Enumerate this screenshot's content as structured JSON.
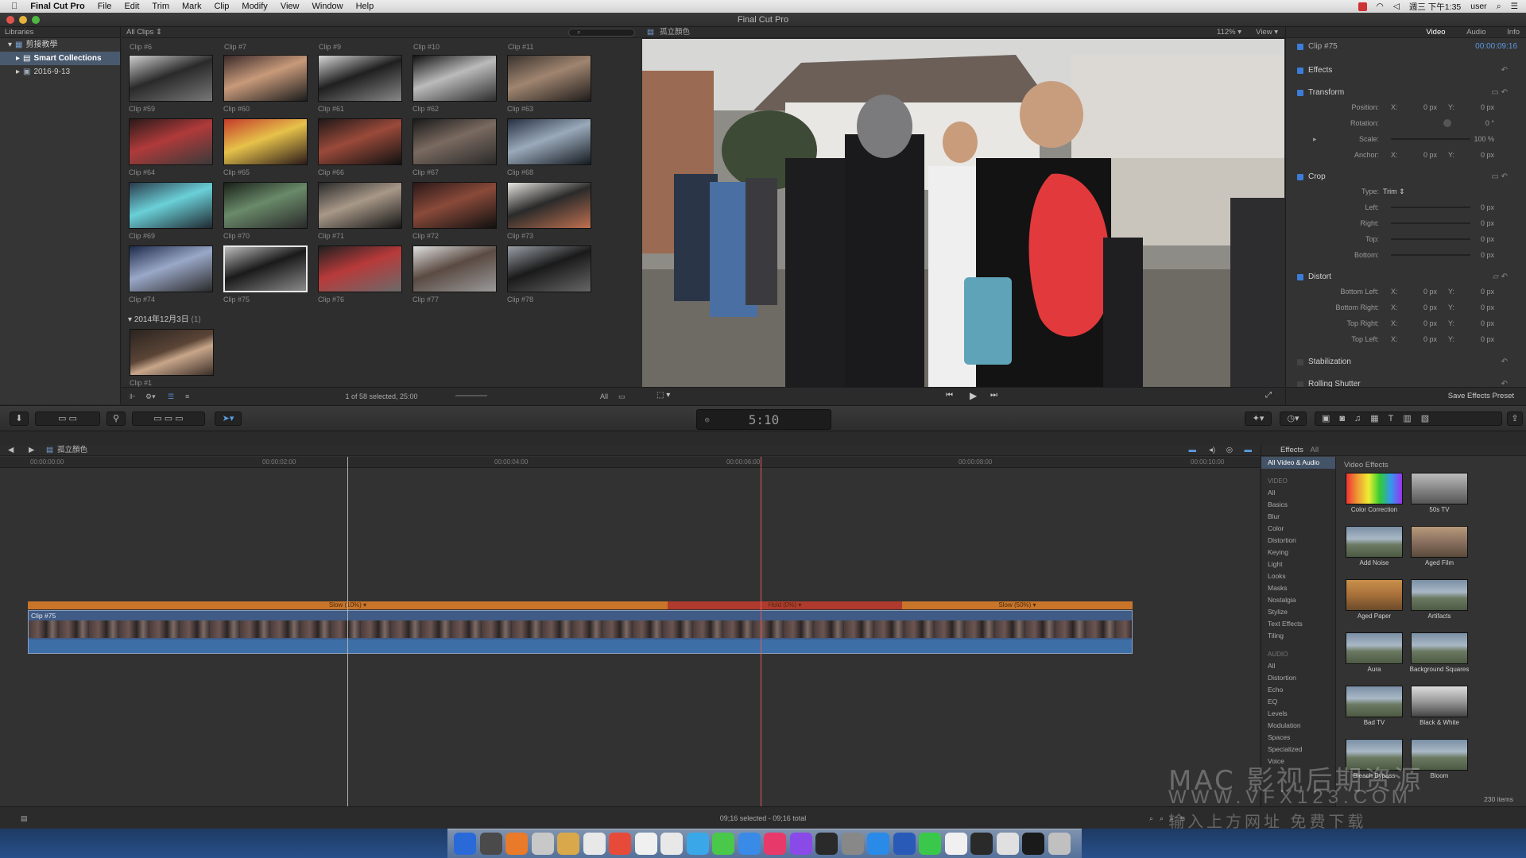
{
  "menubar": {
    "app": "Final Cut Pro",
    "items": [
      "File",
      "Edit",
      "Trim",
      "Mark",
      "Clip",
      "Modify",
      "View",
      "Window",
      "Help"
    ],
    "clock": "週三 下午1:35",
    "user": "user"
  },
  "window": {
    "title": "Final Cut Pro"
  },
  "libraries": {
    "header": "Libraries",
    "items": [
      {
        "label": "剪接教學"
      },
      {
        "label": "Smart Collections"
      },
      {
        "label": "2016-9-13"
      }
    ]
  },
  "browser": {
    "filter": "All Clips",
    "top_labels": [
      "Clip #6",
      "Clip #7",
      "Clip #9",
      "Clip #10",
      "Clip #11"
    ],
    "clips": [
      {
        "label": "Clip #59"
      },
      {
        "label": "Clip #60"
      },
      {
        "label": "Clip #61"
      },
      {
        "label": "Clip #62"
      },
      {
        "label": "Clip #63"
      },
      {
        "label": "Clip #64"
      },
      {
        "label": "Clip #65"
      },
      {
        "label": "Clip #66"
      },
      {
        "label": "Clip #67"
      },
      {
        "label": "Clip #68"
      },
      {
        "label": "Clip #69"
      },
      {
        "label": "Clip #70"
      },
      {
        "label": "Clip #71"
      },
      {
        "label": "Clip #72"
      },
      {
        "label": "Clip #73"
      },
      {
        "label": "Clip #74"
      },
      {
        "label": "Clip #75"
      },
      {
        "label": "Clip #76"
      },
      {
        "label": "Clip #77"
      },
      {
        "label": "Clip #78"
      }
    ],
    "date_group": "2014年12月3日",
    "date_count": "(1)",
    "date_clip": "Clip #1",
    "footer": "1 of 58 selected, 25:00",
    "all_label": "All"
  },
  "viewer": {
    "title": "孤立顏色",
    "zoom": "112%",
    "view": "View"
  },
  "inspector": {
    "tabs": [
      "Video",
      "Audio",
      "Info"
    ],
    "clip": "Clip #75",
    "duration": "00:00:09:16",
    "sections": {
      "effects": "Effects",
      "transform": "Transform",
      "crop": "Crop",
      "distort": "Distort",
      "stabilization": "Stabilization",
      "rolling": "Rolling Shutter"
    },
    "transform_rows": [
      {
        "k": "Position:",
        "x": "0 px",
        "y": "0 px"
      },
      {
        "k": "Rotation:",
        "v": "0 °"
      },
      {
        "k": "Scale:",
        "v": "100 %"
      },
      {
        "k": "Anchor:",
        "x": "0 px",
        "y": "0 px"
      }
    ],
    "crop_type_label": "Type:",
    "crop_type": "Trim",
    "crop_rows": [
      {
        "k": "Left:",
        "v": "0 px"
      },
      {
        "k": "Right:",
        "v": "0 px"
      },
      {
        "k": "Top:",
        "v": "0 px"
      },
      {
        "k": "Bottom:",
        "v": "0 px"
      }
    ],
    "distort_rows": [
      {
        "k": "Bottom Left:",
        "x": "0 px",
        "y": "0 px"
      },
      {
        "k": "Bottom Right:",
        "x": "0 px",
        "y": "0 px"
      },
      {
        "k": "Top Right:",
        "x": "0 px",
        "y": "0 px"
      },
      {
        "k": "Top Left:",
        "x": "0 px",
        "y": "0 px"
      }
    ],
    "save_preset": "Save Effects Preset"
  },
  "toolbar": {
    "timecode": "5:10"
  },
  "timeline": {
    "project": "孤立顏色",
    "ruler": [
      "00:00:00:00",
      "00:00:02:00",
      "00:00:04:00",
      "00:00:06:00",
      "00:00:08:00",
      "00:00:10:00"
    ],
    "speed": [
      "Slow (10%) ▾",
      "Hold (0%) ▾",
      "Slow (50%) ▾"
    ],
    "clip": "Clip #75"
  },
  "effects": {
    "header": "Effects",
    "all": "All",
    "selected_cat": "All Video & Audio",
    "video_hdr": "VIDEO",
    "video_cats": [
      "All",
      "Basics",
      "Blur",
      "Color",
      "Distortion",
      "Keying",
      "Light",
      "Looks",
      "Masks",
      "Nostalgia",
      "Stylize",
      "Text Effects",
      "Tiling"
    ],
    "audio_hdr": "AUDIO",
    "audio_cats": [
      "All",
      "Distortion",
      "Echo",
      "EQ",
      "Levels",
      "Modulation",
      "Spaces",
      "Specialized",
      "Voice"
    ],
    "grid_title": "Video Effects",
    "items": [
      "Color Correction",
      "50s TV",
      "Add Noise",
      "Aged Film",
      "Aged Paper",
      "Artifacts",
      "Aura",
      "Background Squares",
      "Bad TV",
      "Black & White",
      "Bleach Bypass",
      "Bloom"
    ],
    "count": "230 items"
  },
  "status": {
    "text": "09;16 selected - 09;16 total"
  },
  "watermark": {
    "line1": "MAC 影视后期资源",
    "line2": "WWW.VFX123.COM",
    "line3": "输入上方网址 免费下载"
  },
  "colors": {
    "accent": "#3b7dd8",
    "playhead": "#e35b5b",
    "speed": "#c8752a",
    "clip": "#3f5b86"
  }
}
